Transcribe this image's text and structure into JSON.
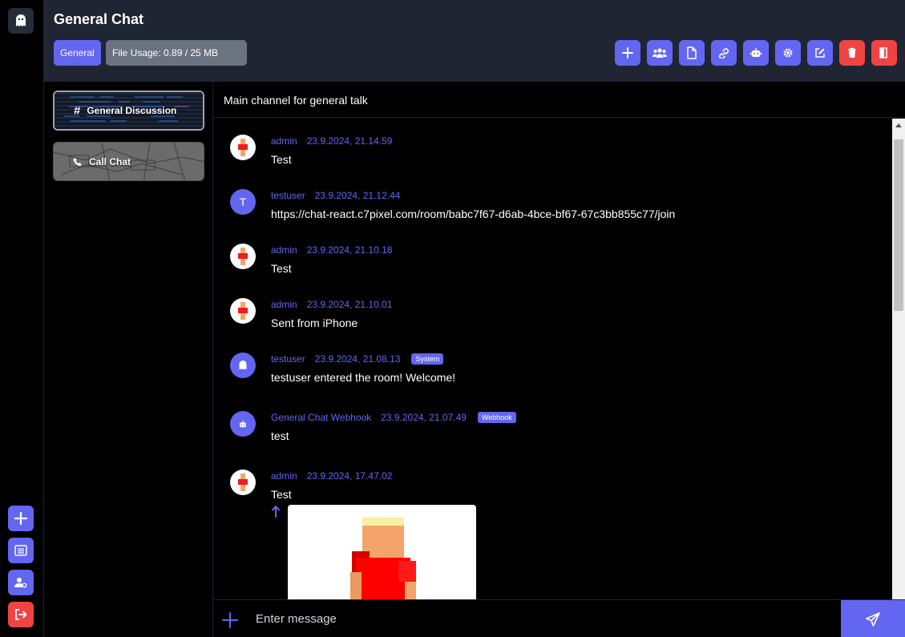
{
  "header": {
    "title": "General Chat",
    "category_label": "General",
    "file_usage": "File Usage: 0.89 / 25 MB"
  },
  "toolbar": [
    {
      "icon": "plus-icon",
      "color": "#6366f1"
    },
    {
      "icon": "users-icon",
      "color": "#6366f1"
    },
    {
      "icon": "file-icon",
      "color": "#6366f1"
    },
    {
      "icon": "link-icon",
      "color": "#6366f1"
    },
    {
      "icon": "robot-icon",
      "color": "#6366f1"
    },
    {
      "icon": "gear-icon",
      "color": "#6366f1"
    },
    {
      "icon": "edit-icon",
      "color": "#6366f1"
    },
    {
      "icon": "trash-icon",
      "color": "#ef4444"
    },
    {
      "icon": "door-exit-icon",
      "color": "#ef4444"
    }
  ],
  "rail": {
    "items": [
      "ghost-logo-icon",
      "plus-icon",
      "list-icon",
      "user-settings-icon",
      "logout-icon"
    ]
  },
  "channels": [
    {
      "label": "General Discussion",
      "icon": "hash-icon",
      "active": true
    },
    {
      "label": "Call Chat",
      "icon": "phone-icon",
      "active": false
    }
  ],
  "topic": "Main channel for general talk",
  "messages": [
    {
      "user": "admin",
      "time": "23.9.2024, 21.14.59",
      "text": "Test",
      "avatar": "admin"
    },
    {
      "user": "testuser",
      "time": "23.9.2024, 21.12.44",
      "text": "https://chat-react.c7pixel.com/room/babc7f67-d6ab-4bce-bf67-67c3bb855c77/join",
      "avatar": "T"
    },
    {
      "user": "admin",
      "time": "23.9.2024, 21.10.18",
      "text": "Test",
      "avatar": "admin"
    },
    {
      "user": "admin",
      "time": "23.9.2024, 21.10.01",
      "text": "Sent from iPhone",
      "avatar": "admin"
    },
    {
      "user": "testuser",
      "time": "23.9.2024, 21.08.13",
      "badge": "System",
      "text": "testuser entered the room! Welcome!",
      "avatar": "ghost"
    },
    {
      "user": "General Chat Webhook",
      "time": "23.9.2024, 21.07.49",
      "badge": "Webhook",
      "text": "test",
      "avatar": "robot"
    },
    {
      "user": "admin",
      "time": "23.9.2024, 17.47.02",
      "text": "Test",
      "avatar": "admin"
    }
  ],
  "composer": {
    "placeholder": "Enter message"
  },
  "colors": {
    "accent": "#6366f1",
    "danger": "#ef4444",
    "header_bg": "#1f2533"
  }
}
